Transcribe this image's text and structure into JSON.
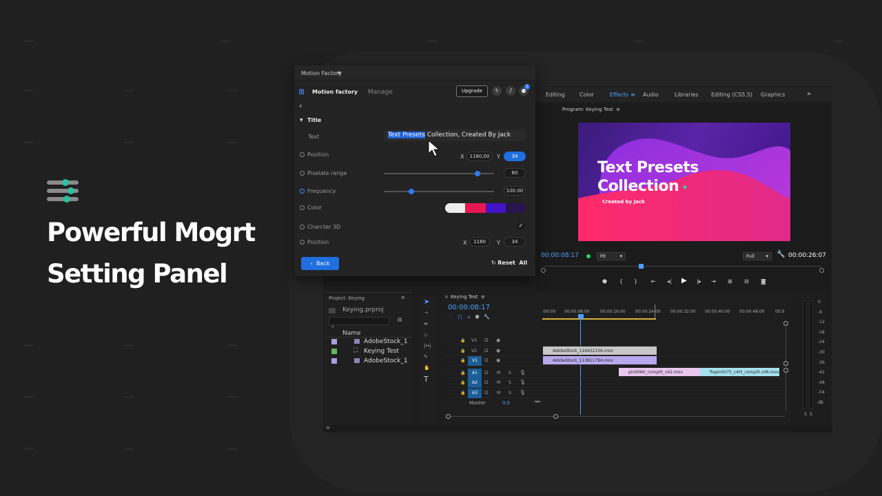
{
  "headline": {
    "line1": "Powerful Mogrt",
    "line2": "Setting Panel"
  },
  "panel": {
    "window_title": "Motion Factory",
    "brand": "Motion factory",
    "manage": "Manage",
    "upgrade": "Upgrade",
    "notify_count": "1",
    "section_title": "Title",
    "rows": {
      "text_label": "Text",
      "text_selected": "Text Presets",
      "text_rest": " Collection, Created By Jack",
      "position_label": "Position",
      "position_x_label": "X",
      "position_x": "1180,00",
      "position_y_label": "Y",
      "position_y": "34",
      "pixelate_label": "Pixelate range",
      "pixelate_value": "60",
      "pixelate_level": 0.85,
      "frequency_label": "Frequency",
      "frequency_value": "100.00",
      "frequency_level": 0.25,
      "color_label": "Color",
      "colors": [
        "#ededed",
        "#e8174f",
        "#4213c9",
        "#2a1450"
      ],
      "character3d_label": "Charcter 3D",
      "character3d_checked": true,
      "position2_label": "Position",
      "position2_x_label": "X",
      "position2_x": "1180",
      "position2_y_label": "Y",
      "position2_y": "34"
    },
    "back": "Back",
    "reset": "Reset  All"
  },
  "premiere": {
    "tabs": [
      "Editing",
      "Color",
      "Effects",
      "Audio",
      "Libraries",
      "Editing (CS5.5)",
      "Graphics"
    ],
    "active_tab": "Effects",
    "more": "»",
    "program_title": "Program: Keying Test",
    "video_title_1": "Text Presets",
    "video_title_2": "Collection",
    "video_credit": "Created by Jack",
    "timecode_left": "00:00:08:17",
    "fit": "Fit",
    "full": "Full",
    "timecode_right": "00:00:26:07",
    "project_title": "Project: Keying",
    "project_file": "Keying.prproj",
    "name_col": "Name",
    "project_items": [
      {
        "name": "AdobeStock_1",
        "color": "#a89ee0"
      },
      {
        "name": "Keying Test",
        "color": "#5fb85a"
      },
      {
        "name": "AdobeStock_1",
        "color": "#a89ee0"
      }
    ],
    "sequence_title": "Keying Test",
    "sequence_timecode": "00:00:08:17",
    "ruler": [
      ":00:00",
      "00:00:08:00",
      "00:00:16:00",
      "00:00:24:00",
      "00:00:32:00",
      "00:00:40:00",
      "00:00:48:00",
      "00:0"
    ],
    "tracks": [
      {
        "label": "V3"
      },
      {
        "label": "V2"
      },
      {
        "label": "V1"
      },
      {
        "label": "A1"
      },
      {
        "label": "A2"
      },
      {
        "label": "A3"
      }
    ],
    "master": "Master",
    "master_value": "0.0",
    "clips": {
      "v2": "AdobeStock_116452106.mov",
      "v1": "AdobeStock_113811794.mov",
      "a1a": "pin0060_compilt_v02.mov",
      "a1b": "fixpin0075_c4hl_compilt.v06.mov"
    },
    "meter_scale": [
      "0",
      "-6",
      "-12",
      "-18",
      "-24",
      "-30",
      "-36",
      "-42",
      "-48",
      "-54",
      "dB"
    ],
    "meter_solo": [
      "S",
      "S"
    ]
  }
}
